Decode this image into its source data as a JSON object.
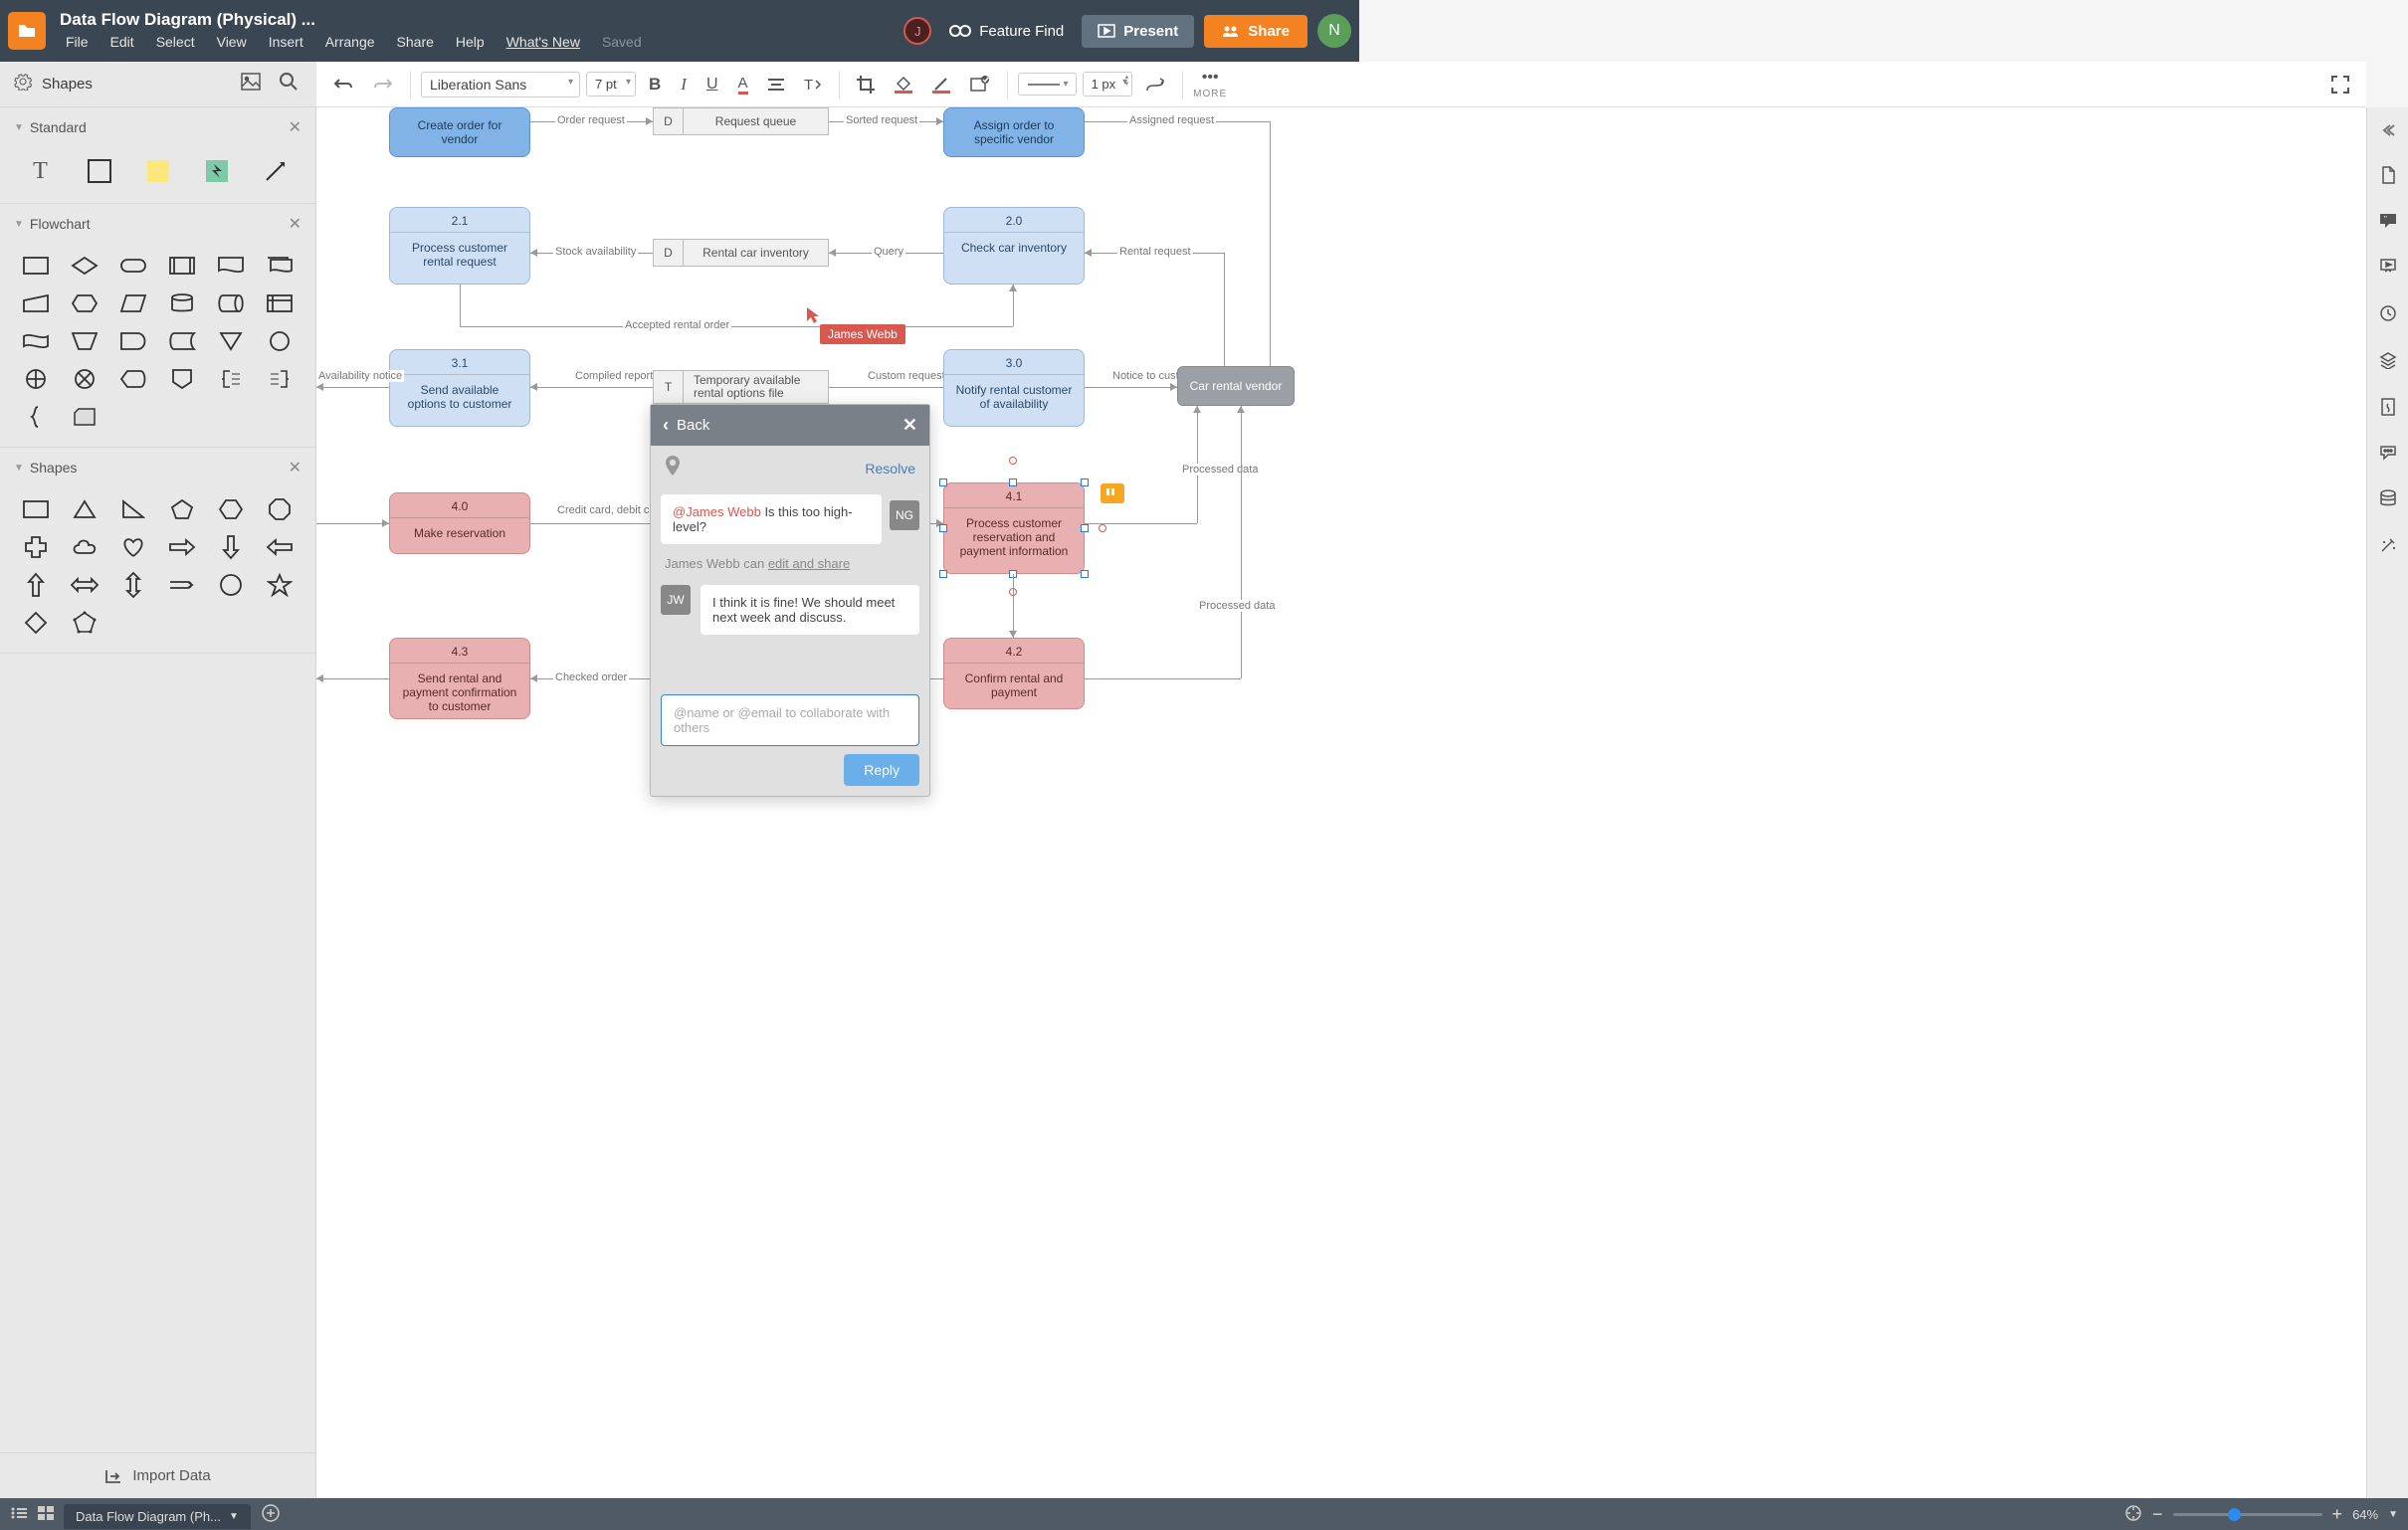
{
  "header": {
    "doc_title": "Data Flow Diagram (Physical) ...",
    "menu": [
      "File",
      "Edit",
      "Select",
      "View",
      "Insert",
      "Arrange",
      "Share",
      "Help",
      "What's New"
    ],
    "saved": "Saved",
    "avatar_j": "J",
    "feature_find": "Feature Find",
    "present": "Present",
    "share": "Share",
    "avatar_n": "N"
  },
  "shapes_header": {
    "label": "Shapes"
  },
  "toolbar": {
    "font": "Liberation Sans",
    "size": "7 pt",
    "line_width": "1 px",
    "more": "MORE"
  },
  "sections": {
    "standard": "Standard",
    "flowchart": "Flowchart",
    "shapes": "Shapes"
  },
  "import_data": "Import Data",
  "canvas": {
    "nodes": {
      "create_order": {
        "txt": "Create order for vendor"
      },
      "request_queue": {
        "tag": "D",
        "txt": "Request queue"
      },
      "assign_order": {
        "txt": "Assign order to specific vendor"
      },
      "n21": {
        "num": "2.1",
        "txt": "Process customer rental request"
      },
      "rental_inv": {
        "tag": "D",
        "txt": "Rental car inventory"
      },
      "n20": {
        "num": "2.0",
        "txt": "Check car inventory"
      },
      "n31": {
        "num": "3.1",
        "txt": "Send available options to customer"
      },
      "temp_file": {
        "tag": "T",
        "txt": "Temporary available rental options file"
      },
      "n30": {
        "num": "3.0",
        "txt": "Notify rental customer of availability"
      },
      "vendor": "Car rental vendor",
      "n40": {
        "num": "4.0",
        "txt": "Make reservation"
      },
      "n41": {
        "num": "4.1",
        "txt": "Process customer reservation and payment information"
      },
      "n43": {
        "num": "4.3",
        "txt": "Send rental and payment confirmation to customer"
      },
      "n42": {
        "num": "4.2",
        "txt": "Confirm rental and payment"
      }
    },
    "labels": {
      "order_request": "Order request",
      "sorted_request": "Sorted request",
      "assigned_request": "Assigned request",
      "stock_avail": "Stock availability",
      "query": "Query",
      "rental_request": "Rental request",
      "accepted": "Accepted rental order",
      "compiled": "Compiled report",
      "custom_req": "Custom request",
      "notice": "Notice to customer",
      "avail_notice": "Availability notice",
      "credit": "Credit card, debit card, or cash",
      "processed": "Processed data",
      "processed2": "Processed data",
      "checked": "Checked order"
    },
    "cursor_user": "James Webb"
  },
  "comments": {
    "back": "Back",
    "resolve": "Resolve",
    "msg1_mention": "@James Webb",
    "msg1_text": " Is this too high-level?",
    "msg1_initials": "NG",
    "perm_name": "James Webb can ",
    "perm_link": "edit and share",
    "msg2_initials": "JW",
    "msg2_text": "I think it is fine! We should meet next week and discuss.",
    "placeholder": "@name or @email to collaborate with others",
    "reply": "Reply"
  },
  "bottom": {
    "tab": "Data Flow Diagram (Ph...",
    "zoom": "64%"
  }
}
